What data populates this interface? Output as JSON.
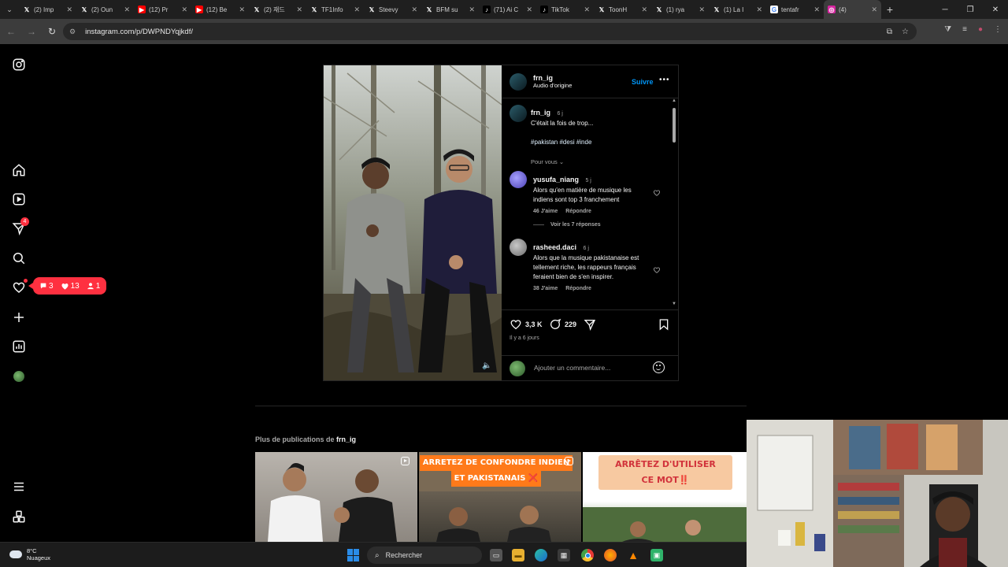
{
  "browser": {
    "tabs": [
      {
        "icon": "x-icon",
        "title": "(2) Imp"
      },
      {
        "icon": "x-icon",
        "title": "(2) Oun"
      },
      {
        "icon": "youtube-icon",
        "title": "(12) Pr"
      },
      {
        "icon": "youtube-icon",
        "title": "(12) Be"
      },
      {
        "icon": "x-icon",
        "title": "(2) 재드"
      },
      {
        "icon": "x-icon",
        "title": "TF1Info"
      },
      {
        "icon": "x-icon",
        "title": "Steevy"
      },
      {
        "icon": "x-icon",
        "title": "BFM su"
      },
      {
        "icon": "tiktok-icon",
        "title": "(71) Ai C"
      },
      {
        "icon": "tiktok-icon",
        "title": "TikTok"
      },
      {
        "icon": "x-icon",
        "title": "ToonH"
      },
      {
        "icon": "x-icon",
        "title": "(1) rya"
      },
      {
        "icon": "x-icon",
        "title": "(1) La I"
      },
      {
        "icon": "google-icon",
        "title": "tentafr"
      },
      {
        "icon": "instagram-icon",
        "title": "(4)"
      }
    ],
    "url": "instagram.com/p/DWPNDYqjkdf/"
  },
  "nav": {
    "notifications_badge": "4",
    "activity": {
      "comments": "3",
      "likes": "13",
      "follows": "1"
    }
  },
  "post": {
    "author": "frn_ig",
    "audio": "Audio d'origine",
    "follow_label": "Suivre",
    "more_label": "•••",
    "caption": {
      "username": "frn_ig",
      "time": "6 j",
      "text": "C'était la fois de trop...",
      "hashtags": "#pakistan #desi #inde",
      "pour_vous": "Pour vous"
    },
    "comments": [
      {
        "username": "yusufa_niang",
        "time": "5 j",
        "text": "Alors qu'en matière de musique les indiens sont top 3 franchement",
        "likes": "46 J'aime",
        "reply": "Répondre",
        "view_replies": "Voir les 7 réponses"
      },
      {
        "username": "rasheed.daci",
        "time": "6 j",
        "text": "Alors que la musique pakistanaise est tellement riche, les rappeurs français feraient bien de s'en inspirer.",
        "likes": "38 J'aime",
        "reply": "Répondre"
      }
    ],
    "likes_count": "3,3 K",
    "comments_count": "229",
    "date": "Il y a 6 jours",
    "add_comment_placeholder": "Ajouter un commentaire..."
  },
  "more": {
    "title_prefix": "Plus de publications de",
    "author": "frn_ig",
    "tiles": [
      {
        "text": ""
      },
      {
        "text_line1": "ARRETEZ DE CONFONDRE INDIEN",
        "text_line2": "ET PAKISTANAIS ❌"
      },
      {
        "text_line1": "ARRÊTEZ D'UTILISER",
        "text_line2": "CE MOT‼️"
      }
    ]
  },
  "taskbar": {
    "weather_temp": "8°C",
    "weather_desc": "Nuageux",
    "search_placeholder": "Rechercher"
  },
  "colors": {
    "follow_blue": "#0095f6",
    "notif_red": "#ff3040",
    "background": "#000000"
  }
}
